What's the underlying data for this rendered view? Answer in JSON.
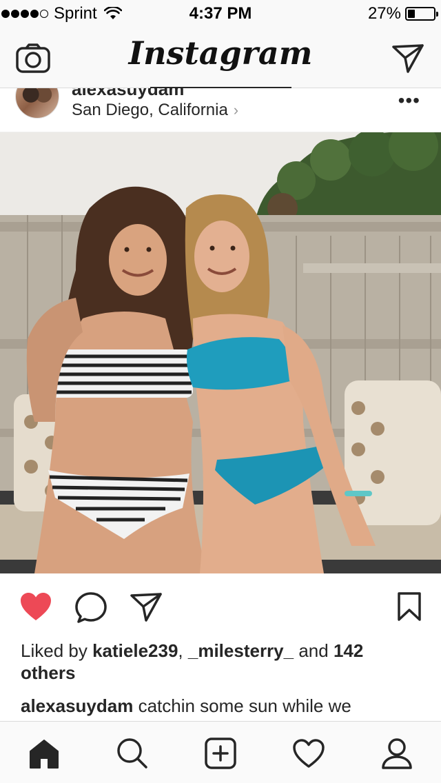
{
  "status_bar": {
    "carrier": "Sprint",
    "time": "4:37 PM",
    "battery_percent": "27%",
    "battery_level": 0.27,
    "signal_bars": 4,
    "signal_total": 5
  },
  "nav": {
    "logo": "Instagram",
    "left_icon": "camera-icon",
    "right_icon": "direct-send-icon"
  },
  "post": {
    "username_partial": "alexasuydam",
    "location": "San Diego, California",
    "location_chevron": "›",
    "more": "•••",
    "liked_by_prefix": "Liked by",
    "liked_by_user1": "katiele239",
    "liked_by_sep": ",",
    "liked_by_user2": "_milesterry_",
    "liked_by_and": "and",
    "liked_by_others": "142 others",
    "caption_user": "alexasuydam",
    "caption_text": "catchin some sun while we",
    "liked": true,
    "colors": {
      "heart": "#ed4956",
      "text": "#262626"
    }
  },
  "tabs": [
    {
      "name": "home",
      "icon": "home-icon",
      "active": true
    },
    {
      "name": "search",
      "icon": "search-icon",
      "active": false
    },
    {
      "name": "add",
      "icon": "add-icon",
      "active": false
    },
    {
      "name": "activity",
      "icon": "heart-icon",
      "active": false
    },
    {
      "name": "profile",
      "icon": "profile-icon",
      "active": false
    }
  ]
}
